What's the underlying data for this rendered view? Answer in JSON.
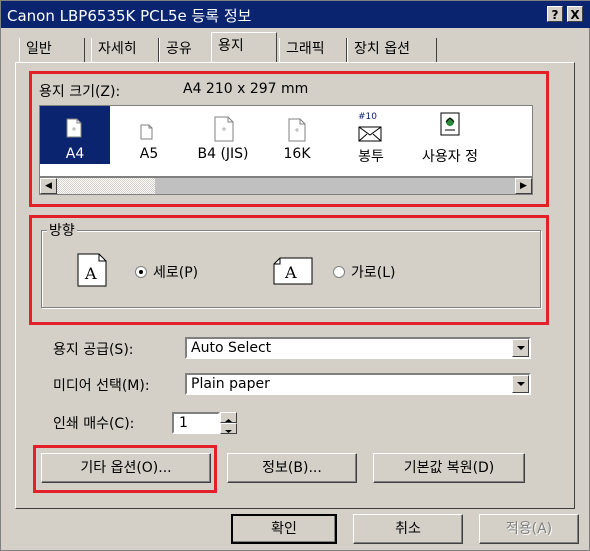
{
  "window": {
    "title": "Canon LBP6535K PCL5e 등록 정보",
    "help_btn": "?",
    "close_btn": "X"
  },
  "tabs": [
    "일반",
    "자세히",
    "공유",
    "용지",
    "그래픽",
    "장치 옵션"
  ],
  "active_tab": "용지",
  "paper_size": {
    "label": "용지 크기(Z):",
    "value": "A4 210 x 297 mm",
    "items": [
      {
        "label": "A4",
        "selected": true,
        "icon": "page-icon"
      },
      {
        "label": "A5",
        "selected": false,
        "icon": "page-icon"
      },
      {
        "label": "B4 (JIS)",
        "selected": false,
        "icon": "page-icon"
      },
      {
        "label": "16K",
        "selected": false,
        "icon": "page-icon"
      },
      {
        "label": "봉투",
        "selected": false,
        "icon": "envelope-icon"
      },
      {
        "label": "사용자 정",
        "selected": false,
        "icon": "custom-paper-icon"
      }
    ],
    "envelope_tag": "#10"
  },
  "orientation": {
    "legend": "방향",
    "portrait_label": "세로(P)",
    "landscape_label": "가로(L)",
    "portrait_glyph": "A",
    "landscape_glyph": "A",
    "selected": "portrait"
  },
  "paper_source": {
    "label": "용지 공급(S):",
    "value": "Auto Select"
  },
  "media": {
    "label": "미디어 선택(M):",
    "value": "Plain paper"
  },
  "copies": {
    "label": "인쇄 매수(C):",
    "value": "1"
  },
  "buttons": {
    "more_options": "기타 옵션(O)...",
    "about": "정보(B)...",
    "restore_defaults": "기본값 복원(D)",
    "ok": "확인",
    "cancel": "취소",
    "apply": "적용(A)"
  },
  "colors": {
    "highlight_red": "#e3202a",
    "selection_blue": "#0a2470",
    "face": "#d4d0c8"
  }
}
